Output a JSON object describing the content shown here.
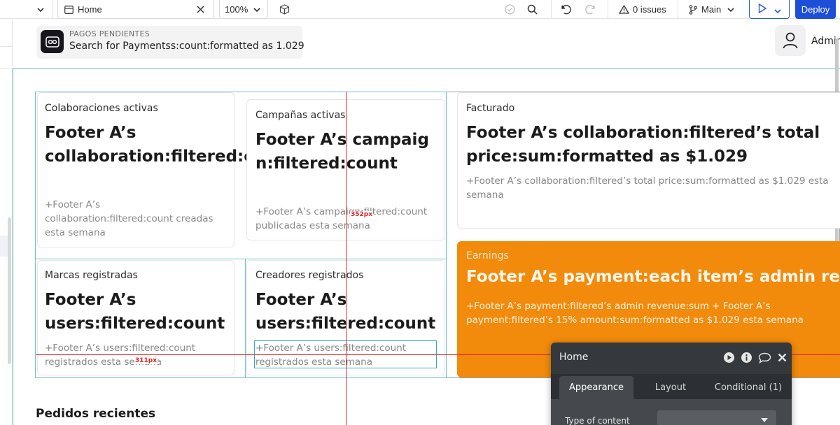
{
  "toolbar": {
    "page_name": "Home",
    "zoom": "100%",
    "issues": "0 issues",
    "branch": "Main",
    "deploy_label": "Deploy"
  },
  "header": {
    "pending_label": "PAGOS PENDIENTES",
    "pending_value": "Search for Paymentss:count:formatted as 1.029",
    "admin_label": "Admin"
  },
  "cards": {
    "collaborations": {
      "label": "Colaboraciones activas",
      "value": "Footer A’s collaboration:filtered:count",
      "note": "+Footer A’s collaboration:filtered:count creadas esta semana"
    },
    "campaigns": {
      "label": "Campañas activas",
      "value": "Footer A’s campaign:filtered:count",
      "note": "+Footer A’s campaign:filtered:count publicadas esta semana"
    },
    "billed": {
      "label": "Facturado",
      "value": "Footer A’s collaboration:filtered’s total price:sum:formatted as $1.029",
      "note": "+Footer A’s collaboration:filtered’s total price:sum:formatted as $1.029 esta semana"
    },
    "brands": {
      "label": "Marcas registradas",
      "value": "Footer A’s users:filtered:count",
      "note": "+Footer A’s users:filtered:count registrados esta semana"
    },
    "creators": {
      "label": "Creadores registrados",
      "value": "Footer A’s users:filtered:count",
      "note": "+Footer A’s users:filtered:count registrados esta semana"
    },
    "earnings": {
      "label": "Earnings",
      "value": "Footer A’s payment:each item’s admin revenue",
      "note": "+Footer A’s payment:filtered’s admin revenue:sum + Footer A’s payment:filtered’s 15% amount:sum:formatted as $1.029 esta semana",
      "color": "#f28a0c"
    }
  },
  "guides": {
    "vertical_distance": "352px",
    "horizontal_distance": "311px",
    "color": "#e02424"
  },
  "section": {
    "recent_orders": "Pedidos recientes"
  },
  "palette": {
    "title": "Home",
    "tabs": [
      "Appearance",
      "Layout",
      "Conditional (1)"
    ],
    "type_of_content_label": "Type of content",
    "type_of_content_value": ""
  },
  "colors": {
    "accent": "#1d4ed8",
    "selection_outline": "#6fbfd6"
  }
}
